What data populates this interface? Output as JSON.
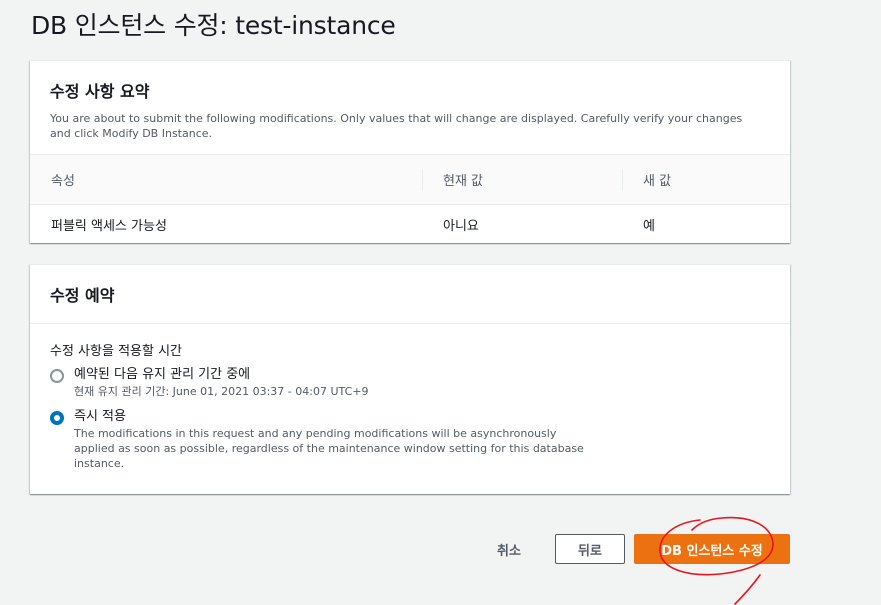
{
  "page": {
    "title": "DB 인스턴스 수정: test-instance"
  },
  "summary": {
    "heading": "수정 사항 요약",
    "description": "You are about to submit the following modifications. Only values that will change are displayed. Carefully verify your changes and click Modify DB Instance.",
    "columns": [
      "속성",
      "현재 값",
      "새 값"
    ],
    "rows": [
      {
        "attribute": "퍼블릭 액세스 가능성",
        "current": "아니요",
        "new": "예"
      }
    ]
  },
  "schedule": {
    "heading": "수정 예약",
    "field_label": "수정 사항을 적용할 시간",
    "options": [
      {
        "label": "예약된 다음 유지 관리 기간 중에",
        "description": "현재 유지 관리 기간: June 01, 2021 03:37 - 04:07 UTC+9",
        "selected": false
      },
      {
        "label": "즉시 적용",
        "description": "The modifications in this request and any pending modifications will be asynchronously applied as soon as possible, regardless of the maintenance window setting for this database instance.",
        "selected": true
      }
    ]
  },
  "actions": {
    "cancel_label": "취소",
    "back_label": "뒤로",
    "modify_label": "DB 인스턴스 수정"
  },
  "colors": {
    "primary_button": "#ec7211",
    "radio_selected": "#0073bb",
    "annotation_stroke": "#e8141c"
  }
}
